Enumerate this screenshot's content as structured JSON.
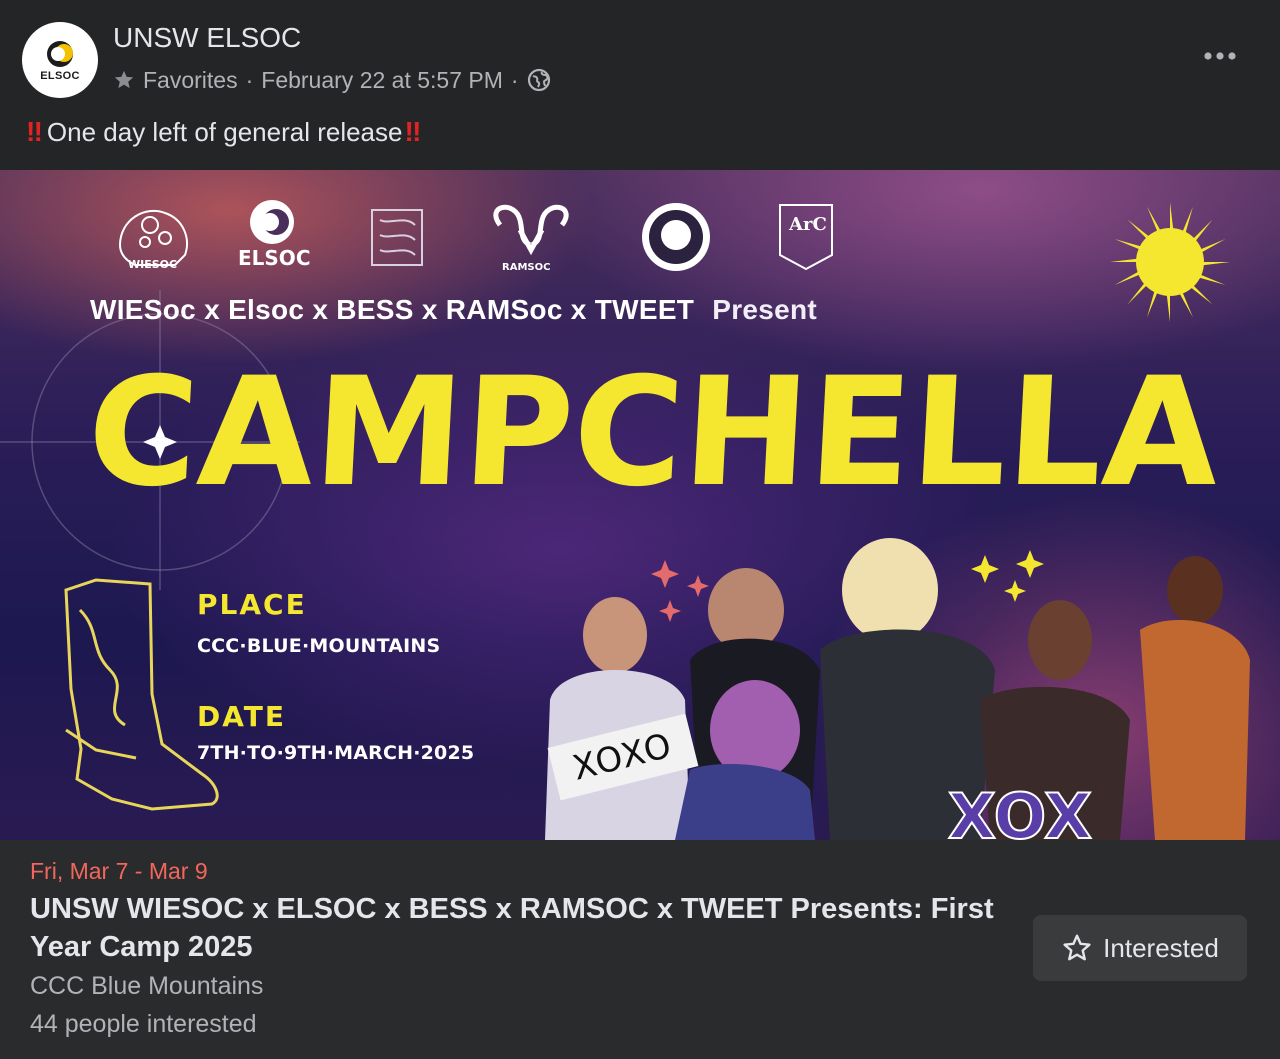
{
  "post": {
    "page_name": "UNSW ELSOC",
    "avatar_text": "ELSOC",
    "audience_label": "Favorites",
    "separator": "·",
    "timestamp": "February 22 at 5:57 PM",
    "privacy_icon": "globe-icon",
    "text": "One day left of general release",
    "emphasis_mark": "‼",
    "more_icon": "more-horizontal-icon"
  },
  "banner": {
    "logo_labels": [
      "WIESOC",
      "ELSOC",
      "RAMSOC",
      "ARC CLUBS"
    ],
    "presenters": "WIESoc x Elsoc x BESS x RAMSoc x TWEET",
    "present": "Present",
    "title_letters": [
      "C",
      "A",
      "M",
      "P",
      "C",
      "H",
      "E",
      "L",
      "L",
      "A"
    ],
    "place_label": "PLACE",
    "place_value": "CCC·BLUE·MOUNTAINS",
    "date_label": "DATE",
    "date_value": "7TH·TO·9TH·MARCH·2025",
    "sticker_text": "XOXO",
    "bottom_art_text": "XOX",
    "accent_color": "#f5e62f"
  },
  "event": {
    "date": "Fri, Mar 7 - Mar 9",
    "title": "UNSW WIESOC x ELSOC x BESS x RAMSOC x TWEET Presents: First Year Camp 2025",
    "location": "CCC Blue Mountains",
    "interested_count": "44 people interested",
    "interested_button": "Interested",
    "date_color": "#f3665c"
  }
}
